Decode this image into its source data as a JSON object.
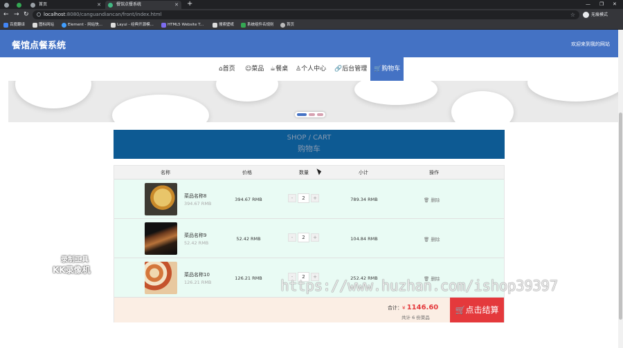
{
  "browser": {
    "tabs": [
      {
        "label": "",
        "active": false
      },
      {
        "label": "",
        "active": false
      },
      {
        "label": "首页",
        "active": false
      },
      {
        "label": "餐馆点餐系统",
        "active": true
      }
    ],
    "new_tab": "+",
    "window_controls": [
      "—",
      "❐",
      "✕"
    ],
    "url_host": "localhost",
    "url_path": ":8080/canguandiancan/front/index.html",
    "profile_label": "无痕模式",
    "bookmarks": [
      "百度翻译",
      "图标网站",
      "Element - 网站快...",
      "Layui - 经典开源模...",
      "HTML5 Website T...",
      "搜索壁纸",
      "系统组件名规则",
      "首页"
    ]
  },
  "header": {
    "logo": "餐馆点餐系统",
    "welcome": "欢迎来到我的网站"
  },
  "nav": {
    "items": [
      {
        "label": "⌂首页"
      },
      {
        "label": "☺菜品"
      },
      {
        "label": "☕餐桌"
      },
      {
        "label": "♙个人中心"
      },
      {
        "label": "🔗后台管理"
      },
      {
        "label": "🛒购物车"
      }
    ]
  },
  "cart": {
    "title_en": "SHOP / CART",
    "title_cn": "购物车",
    "headers": [
      "名称",
      "价格",
      "数量",
      "小计",
      "操作"
    ],
    "rows": [
      {
        "name": "菜品名称8",
        "unit_price": "394.67 RMB",
        "price": "394.67 RMB",
        "qty": "2",
        "subtotal": "789.34 RMB",
        "minus": "-",
        "plus": "+",
        "delete": "删除"
      },
      {
        "name": "菜品名称9",
        "unit_price": "52.42 RMB",
        "price": "52.42 RMB",
        "qty": "2",
        "subtotal": "104.84 RMB",
        "minus": "-",
        "plus": "+",
        "delete": "删除"
      },
      {
        "name": "菜品名称10",
        "unit_price": "126.21 RMB",
        "price": "126.21 RMB",
        "qty": "2",
        "subtotal": "252.42 RMB",
        "minus": "-",
        "plus": "+",
        "delete": "删除"
      }
    ],
    "total_label": "合计：",
    "total_currency": "¥",
    "total_amount": "1146.60",
    "count_label": "共计 6 份菜品",
    "checkout_label": "🛒点击结算"
  },
  "watermarks": {
    "recorder_top": "录制工具",
    "recorder_bottom": "KK录像机",
    "site": "https://www.huzhan.com/ishop39397"
  },
  "colors": {
    "brand_blue": "#4472c4",
    "cart_title_bg": "#0d5a93",
    "row_bg": "#e9fbf4",
    "checkout_red": "#e4393c"
  }
}
